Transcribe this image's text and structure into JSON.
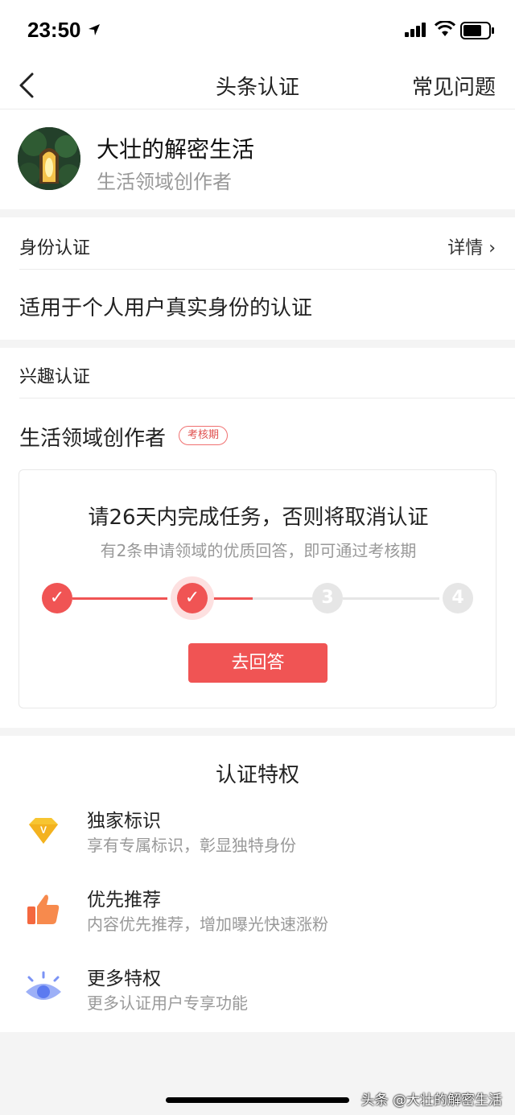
{
  "status_bar": {
    "time": "23:50"
  },
  "nav": {
    "title": "头条认证",
    "faq": "常见问题"
  },
  "profile": {
    "name": "大壮的解密生活",
    "subtitle": "生活领域创作者"
  },
  "identity": {
    "heading": "身份认证",
    "detail": "详情 ›",
    "description": "适用于个人用户真实身份的认证"
  },
  "interest": {
    "heading": "兴趣认证",
    "field": "生活领域创作者",
    "badge": "考核期",
    "task_title": "请26天内完成任务，否则将取消认证",
    "task_subtitle": "有2条申请领域的优质回答，即可通过考核期",
    "progress": {
      "steps": [
        {
          "label": "✓",
          "state": "done"
        },
        {
          "label": "✓",
          "state": "current"
        },
        {
          "label": "3",
          "state": "pending"
        },
        {
          "label": "4",
          "state": "pending"
        }
      ],
      "current_segment_fill": 0.5
    },
    "button": "去回答"
  },
  "privileges": {
    "heading": "认证特权",
    "items": [
      {
        "icon": "diamond-icon",
        "name": "独家标识",
        "desc": "享有专属标识，彰显独特身份"
      },
      {
        "icon": "thumbs-up-icon",
        "name": "优先推荐",
        "desc": "内容优先推荐，增加曝光快速涨粉"
      },
      {
        "icon": "eye-icon",
        "name": "更多特权",
        "desc": "更多认证用户专享功能"
      }
    ]
  },
  "watermark": "头条 @大壮的解密生活",
  "colors": {
    "accent": "#f05454",
    "muted": "#999999",
    "background": "#f4f4f4"
  }
}
